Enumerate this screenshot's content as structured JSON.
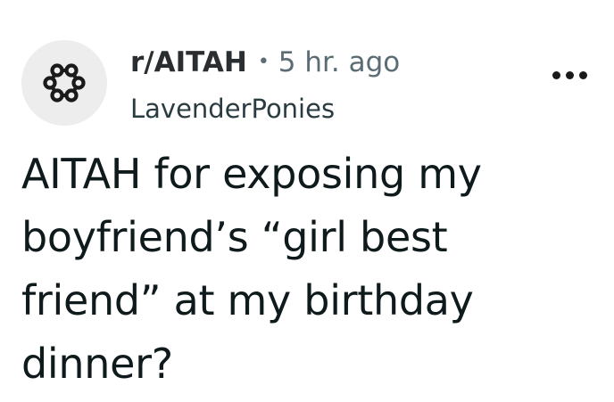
{
  "post": {
    "subreddit": "r/AITAH",
    "separator": "•",
    "age": "5 hr. ago",
    "author": "LavenderPonies",
    "title": "AITAH for exposing my boyfriend’s “girl best friend” at my birthday dinner?"
  },
  "icons": {
    "subreddit_avatar": "community-nodes-icon",
    "overflow_menu": "more-horizontal-icon"
  },
  "colors": {
    "avatar_bg": "#ededed",
    "text_primary": "#0f1a1c",
    "text_secondary": "#5c6c74"
  }
}
